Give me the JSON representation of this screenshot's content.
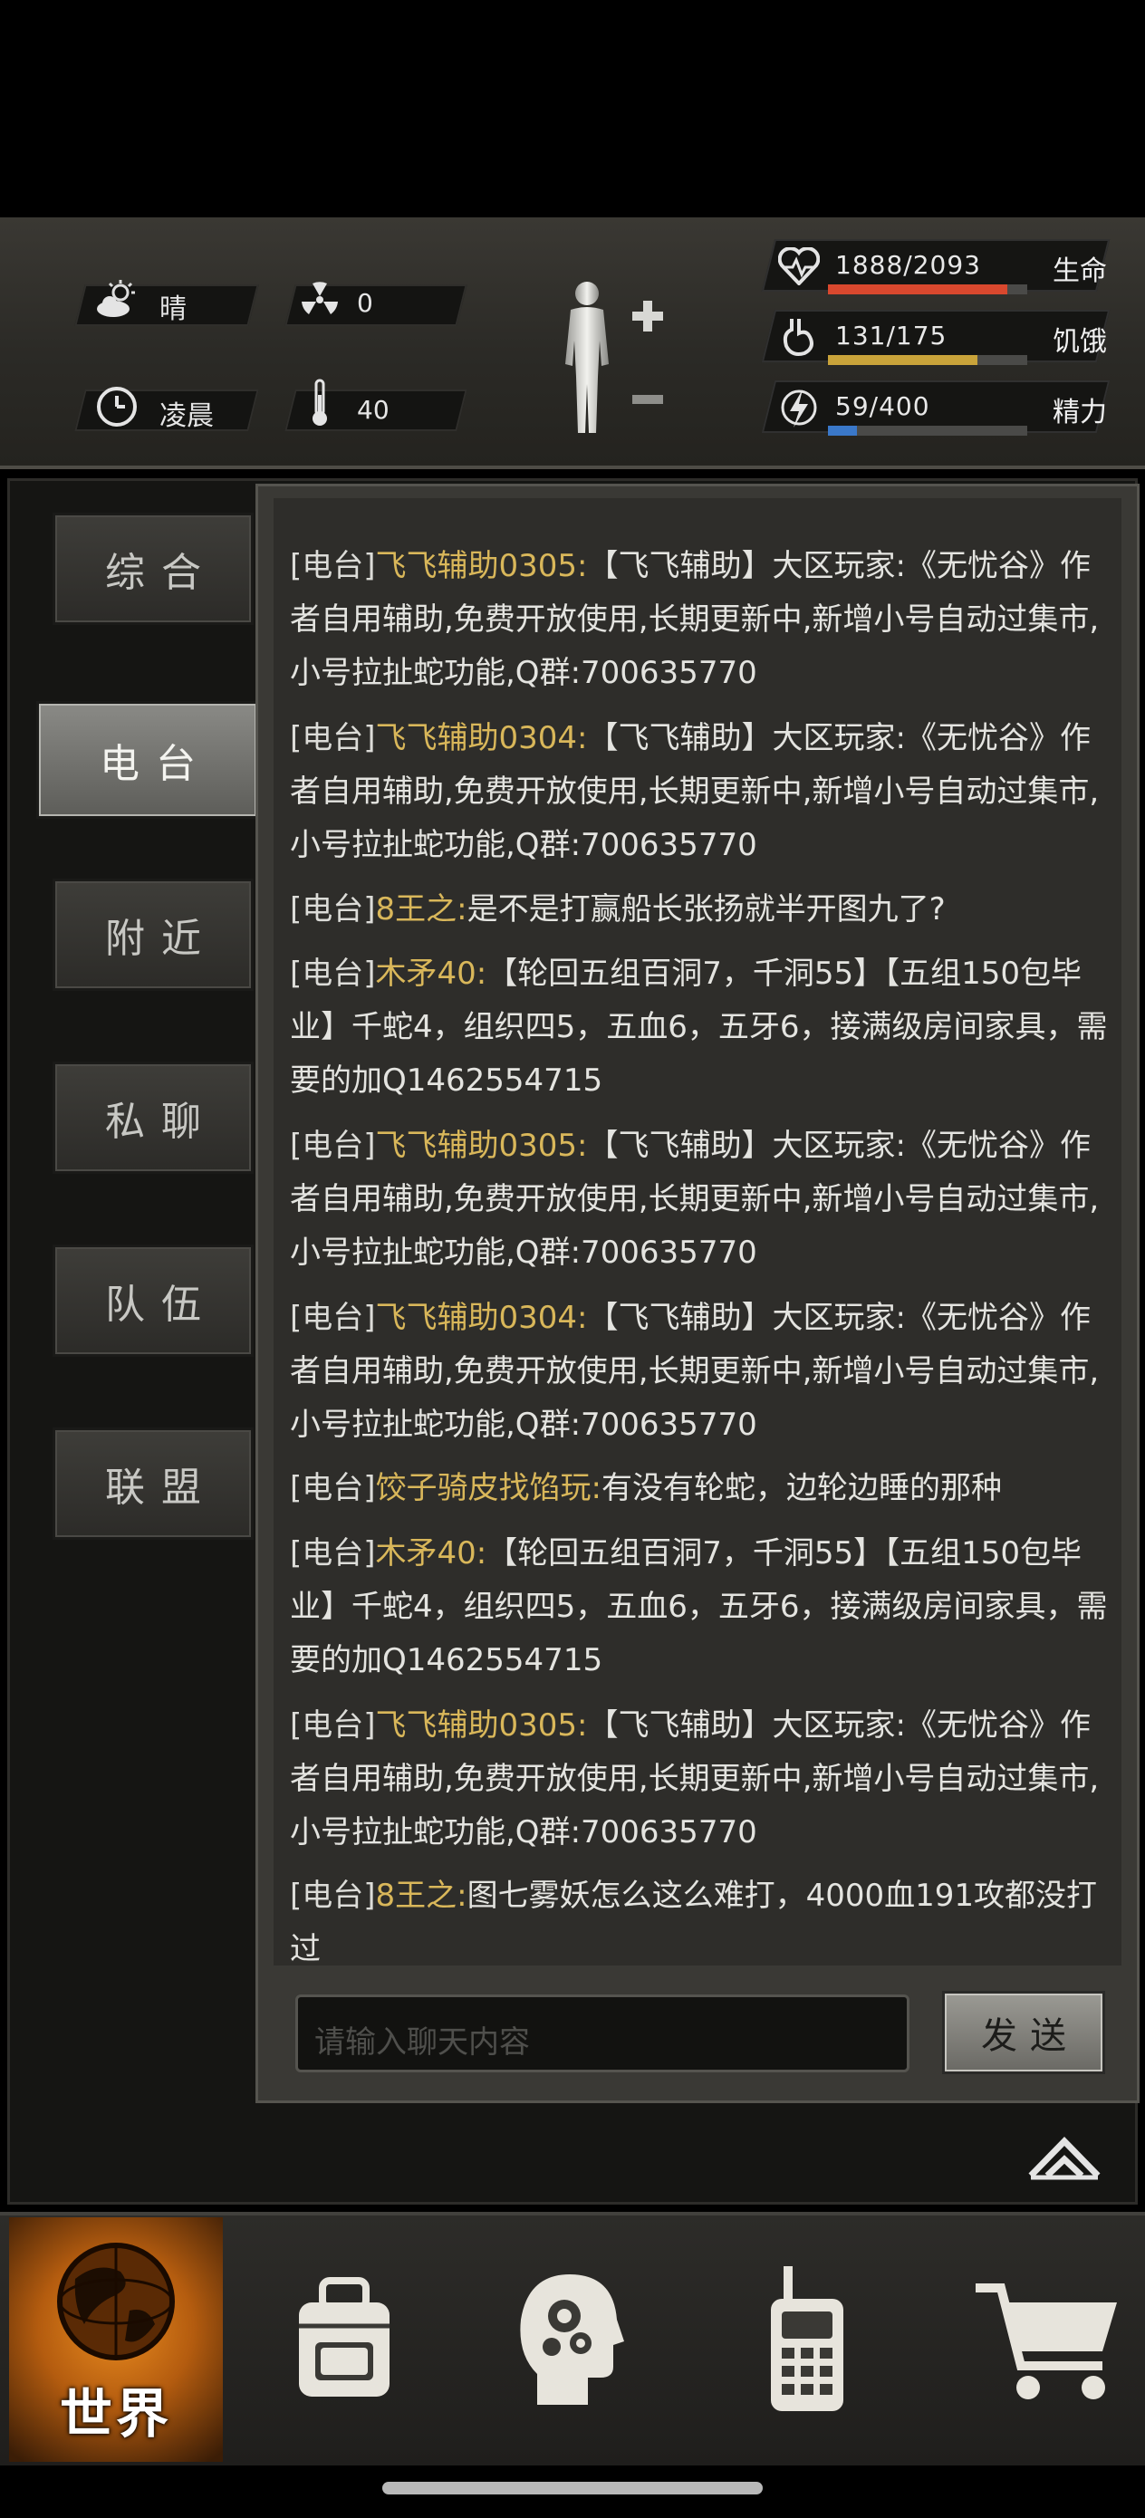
{
  "status": {
    "weather": {
      "icon": "cloud-sun-icon",
      "label": "晴"
    },
    "radiation": {
      "icon": "radiation-icon",
      "value": "0"
    },
    "time_of_day": {
      "icon": "clock-icon",
      "label": "凌晨"
    },
    "temperature": {
      "icon": "thermometer-icon",
      "value": "40"
    },
    "body_icon": "body-figure-icon",
    "bars": [
      {
        "key": "health",
        "icon": "heart-icon",
        "text": "1888/2093",
        "label": "生命",
        "fraction": 0.902,
        "color": "#d9482e"
      },
      {
        "key": "hunger",
        "icon": "stomach-icon",
        "text": "131/175",
        "label": "饥饿",
        "fraction": 0.749,
        "color": "#c9a33a"
      },
      {
        "key": "energy",
        "icon": "lightning-icon",
        "text": "59/400",
        "label": "精力",
        "fraction": 0.1475,
        "color": "#3a78c9"
      }
    ]
  },
  "sidebar": {
    "tabs": [
      {
        "label": "综合",
        "active": false
      },
      {
        "label": "电台",
        "active": true
      },
      {
        "label": "附近",
        "active": false
      },
      {
        "label": "私聊",
        "active": false
      },
      {
        "label": "队伍",
        "active": false
      },
      {
        "label": "联盟",
        "active": false
      }
    ]
  },
  "chat": {
    "messages": [
      {
        "channel": "[电台]",
        "sender": "飞飞辅助0305:",
        "text": "【飞飞辅助】大区玩家:《无忧谷》作者自用辅助,免费开放使用,长期更新中,新增小号自动过集市,小号拉扯蛇功能,Q群:700635770"
      },
      {
        "channel": "[电台]",
        "sender": "飞飞辅助0304:",
        "text": "【飞飞辅助】大区玩家:《无忧谷》作者自用辅助,免费开放使用,长期更新中,新增小号自动过集市,小号拉扯蛇功能,Q群:700635770"
      },
      {
        "channel": "[电台]",
        "sender": "8王之:",
        "text": "是不是打赢船长张扬就半开图九了?"
      },
      {
        "channel": "[电台]",
        "sender": "木矛40:",
        "text": "【轮回五组百洞7，千洞55】【五组150包毕业】千蛇4，组织四5，五血6，五牙6，接满级房间家具，需要的加Q1462554715"
      },
      {
        "channel": "[电台]",
        "sender": "飞飞辅助0305:",
        "text": "【飞飞辅助】大区玩家:《无忧谷》作者自用辅助,免费开放使用,长期更新中,新增小号自动过集市,小号拉扯蛇功能,Q群:700635770"
      },
      {
        "channel": "[电台]",
        "sender": "飞飞辅助0304:",
        "text": "【飞飞辅助】大区玩家:《无忧谷》作者自用辅助,免费开放使用,长期更新中,新增小号自动过集市,小号拉扯蛇功能,Q群:700635770"
      },
      {
        "channel": "[电台]",
        "sender": "饺子骑皮找馅玩:",
        "text": "有没有轮蛇，边轮边睡的那种"
      },
      {
        "channel": "[电台]",
        "sender": "木矛40:",
        "text": "【轮回五组百洞7，千洞55】【五组150包毕业】千蛇4，组织四5，五血6，五牙6，接满级房间家具，需要的加Q1462554715"
      },
      {
        "channel": "[电台]",
        "sender": "飞飞辅助0305:",
        "text": "【飞飞辅助】大区玩家:《无忧谷》作者自用辅助,免费开放使用,长期更新中,新增小号自动过集市,小号拉扯蛇功能,Q群:700635770"
      },
      {
        "channel": "[电台]",
        "sender": "8王之:",
        "text": "图七雾妖怎么这么难打，4000血191攻都没打过"
      }
    ],
    "input_placeholder": "请输入聊天内容",
    "send_label": "发送"
  },
  "bottom_nav": {
    "items": [
      {
        "key": "world",
        "label": "世界",
        "icon": "globe-icon",
        "active": true
      },
      {
        "key": "inventory",
        "icon": "backpack-icon"
      },
      {
        "key": "skills",
        "icon": "head-gears-icon"
      },
      {
        "key": "radio",
        "icon": "walkie-talkie-icon"
      },
      {
        "key": "shop",
        "icon": "shopping-cart-icon"
      }
    ]
  }
}
